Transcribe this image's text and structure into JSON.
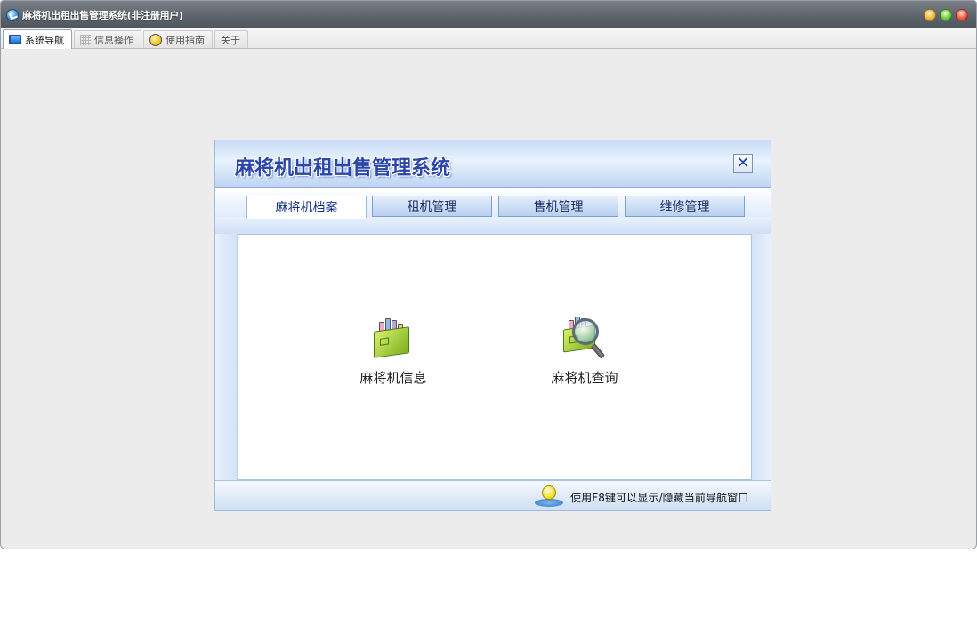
{
  "window": {
    "title": "麻将机出租出售管理系统(非注册用户)"
  },
  "tabs": [
    {
      "label": "系统导航",
      "icon": "monitor-icon",
      "active": true
    },
    {
      "label": "信息操作",
      "icon": "grid-icon",
      "active": false
    },
    {
      "label": "使用指南",
      "icon": "bulb-icon",
      "active": false
    },
    {
      "label": "关于",
      "icon": "",
      "active": false
    }
  ],
  "dialog": {
    "title": "麻将机出租出售管理系统",
    "close_glyph": "✕",
    "tabs": [
      {
        "label": "麻将机档案",
        "active": true
      },
      {
        "label": "租机管理",
        "active": false
      },
      {
        "label": "售机管理",
        "active": false
      },
      {
        "label": "维修管理",
        "active": false
      }
    ],
    "items": [
      {
        "label": "麻将机信息",
        "icon": "archive-books-icon"
      },
      {
        "label": "麻将机查询",
        "icon": "magnifier-search-icon"
      }
    ],
    "footer_tip": "使用F8键可以显示/隐藏当前导航窗口"
  },
  "colors": {
    "accent_title": "#2a46a8",
    "titlebar": "#5e646b",
    "dialog_bg": "#dde9f8"
  }
}
